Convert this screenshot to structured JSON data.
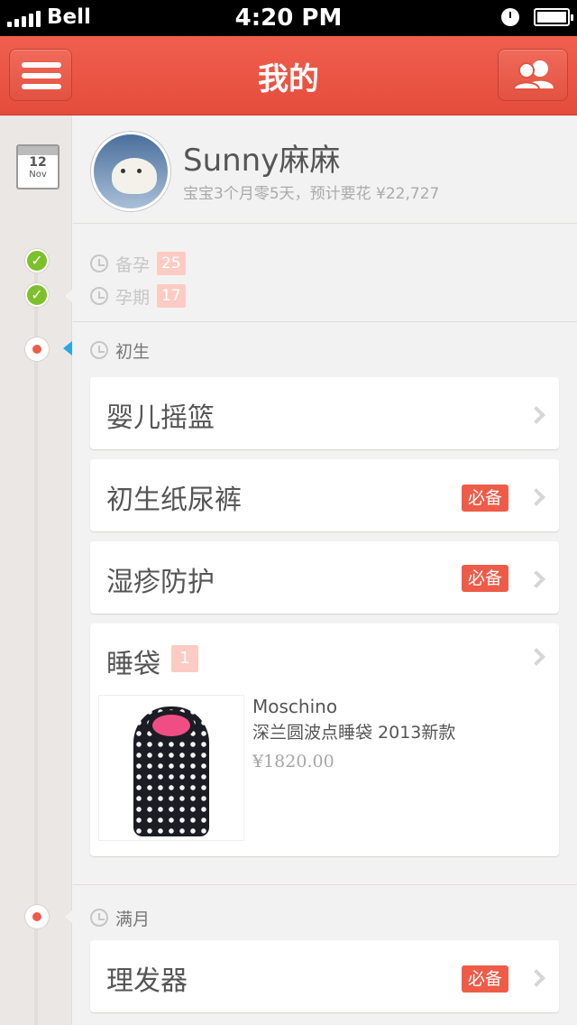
{
  "status_bar": {
    "carrier": "Bell",
    "time": "4:20 PM"
  },
  "header": {
    "title": "我的"
  },
  "calendar": {
    "day": "12",
    "month": "Nov"
  },
  "profile": {
    "name": "Sunny麻麻",
    "subtitle": "宝宝3个月零5天，预计要花 ¥22,727"
  },
  "stages_past": [
    {
      "label": "备孕",
      "count": "25"
    },
    {
      "label": "孕期",
      "count": "17"
    }
  ],
  "stage_newborn": {
    "label": "初生"
  },
  "stage_month": {
    "label": "满月"
  },
  "newborn_items": [
    {
      "title": "婴儿摇篮"
    },
    {
      "title": "初生纸尿裤",
      "tag": "必备"
    },
    {
      "title": "湿疹防护",
      "tag": "必备"
    }
  ],
  "sleeping_bag": {
    "title": "睡袋",
    "count": "1",
    "product": {
      "brand": "Moschino",
      "name": "深兰圆波点睡袋 2013新款",
      "price": "¥1820.00"
    }
  },
  "month_items": [
    {
      "title": "理发器",
      "tag": "必备"
    }
  ],
  "colors": {
    "accent": "#ed5c49",
    "badge_light": "#fecbc4",
    "rail": "#ebe7e4",
    "text": "#555555",
    "muted": "#c6c6c6"
  }
}
